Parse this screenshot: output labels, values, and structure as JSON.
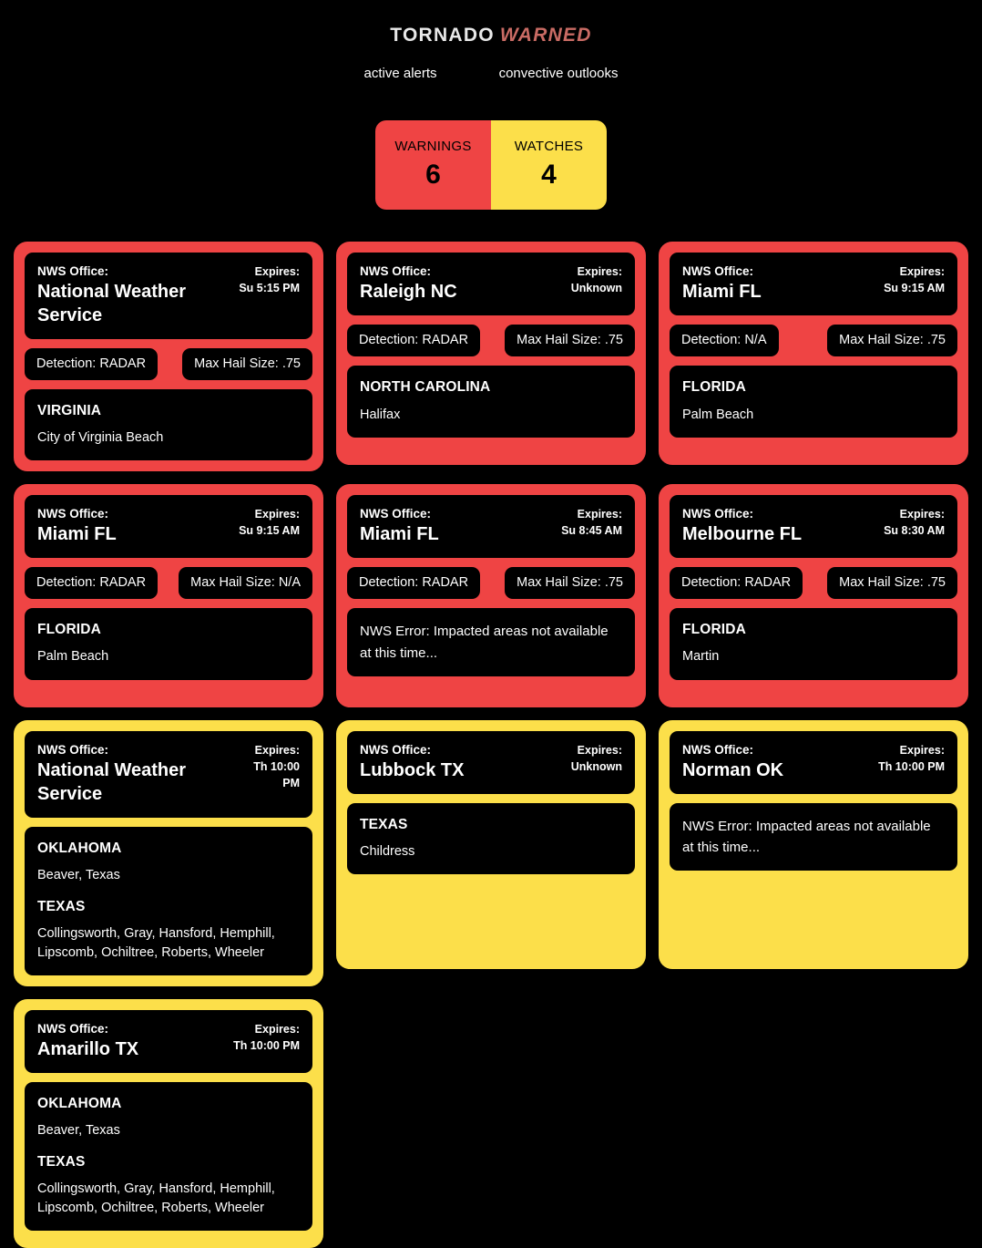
{
  "header": {
    "title_part1": "TORNADO",
    "title_part2": "WARNED",
    "nav": [
      {
        "label": "active alerts"
      },
      {
        "label": "convective outlooks"
      }
    ]
  },
  "counters": [
    {
      "label": "WARNINGS",
      "value": "6",
      "color": "#ef4444"
    },
    {
      "label": "WATCHES",
      "value": "4",
      "color": "#fcdf4a"
    }
  ],
  "labels": {
    "nws_office": "NWS Office:",
    "expires": "Expires:"
  },
  "colors": {
    "warning": "#ef4444",
    "watch": "#fcdf4a",
    "background": "#000000",
    "title_accent": "#c96b64"
  },
  "alerts": [
    {
      "kind": "warning",
      "office": "National Weather Service",
      "expires": "Su 5:15 PM",
      "detection": "Detection: RADAR",
      "hail": "Max Hail Size: .75",
      "areas": [
        {
          "state": "VIRGINIA",
          "counties": "City of Virginia Beach"
        }
      ]
    },
    {
      "kind": "warning",
      "office": "Raleigh NC",
      "expires": "Unknown",
      "detection": "Detection: RADAR",
      "hail": "Max Hail Size: .75",
      "areas": [
        {
          "state": "NORTH CAROLINA",
          "counties": "Halifax"
        }
      ]
    },
    {
      "kind": "warning",
      "office": "Miami FL",
      "expires": "Su 9:15 AM",
      "detection": "Detection: N/A",
      "hail": "Max Hail Size: .75",
      "areas": [
        {
          "state": "FLORIDA",
          "counties": "Palm Beach"
        }
      ]
    },
    {
      "kind": "warning",
      "office": "Miami FL",
      "expires": "Su 9:15 AM",
      "detection": "Detection: RADAR",
      "hail": "Max Hail Size: N/A",
      "areas": [
        {
          "state": "FLORIDA",
          "counties": "Palm Beach"
        }
      ]
    },
    {
      "kind": "warning",
      "office": "Miami FL",
      "expires": "Su 8:45 AM",
      "detection": "Detection: RADAR",
      "hail": "Max Hail Size: .75",
      "error": "NWS Error: Impacted areas not available at this time..."
    },
    {
      "kind": "warning",
      "office": "Melbourne FL",
      "expires": "Su 8:30 AM",
      "detection": "Detection: RADAR",
      "hail": "Max Hail Size: .75",
      "areas": [
        {
          "state": "FLORIDA",
          "counties": "Martin"
        }
      ]
    },
    {
      "kind": "watch",
      "office": "National Weather Service",
      "expires": "Th 10:00 PM",
      "areas": [
        {
          "state": "OKLAHOMA",
          "counties": "Beaver, Texas"
        },
        {
          "state": "TEXAS",
          "counties": "Collingsworth, Gray, Hansford, Hemphill, Lipscomb, Ochiltree, Roberts, Wheeler"
        }
      ]
    },
    {
      "kind": "watch",
      "office": "Lubbock TX",
      "expires": "Unknown",
      "areas": [
        {
          "state": "TEXAS",
          "counties": "Childress"
        }
      ]
    },
    {
      "kind": "watch",
      "office": "Norman OK",
      "expires": "Th 10:00 PM",
      "error": "NWS Error: Impacted areas not available at this time..."
    },
    {
      "kind": "watch",
      "office": "Amarillo TX",
      "expires": "Th 10:00 PM",
      "areas": [
        {
          "state": "OKLAHOMA",
          "counties": "Beaver, Texas"
        },
        {
          "state": "TEXAS",
          "counties": "Collingsworth, Gray, Hansford, Hemphill, Lipscomb, Ochiltree, Roberts, Wheeler"
        }
      ]
    }
  ]
}
